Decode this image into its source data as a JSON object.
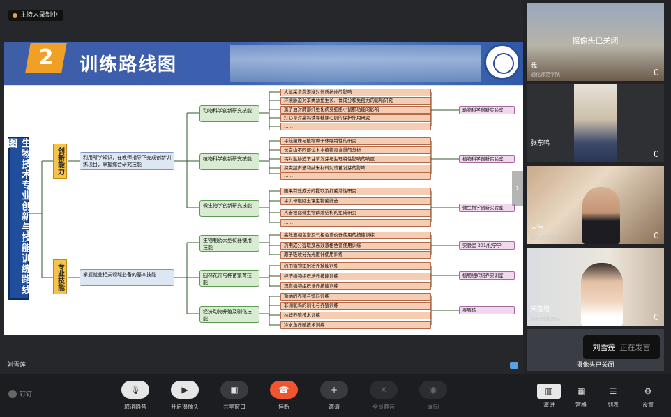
{
  "main": {
    "host_tag": "主持人录制中",
    "speaker_name": "刘雪莲"
  },
  "slide": {
    "number": "2",
    "title": "训练路线图",
    "vertical_title": "生物技术专业创新与技能训练路线图",
    "categories": [
      "创新能力",
      "专业技能"
    ],
    "descriptions": [
      "利用所学知识，在教师指导下完成创新训练项目，掌握综合研究技能",
      "掌握就业相关领域必备的基本技能"
    ],
    "mids": [
      "动物科学创新研究技能",
      "植物科学创新研究技能",
      "微生物学创新研究技能",
      "生物制药大型仪器使用技能",
      "园林花卉与种苗繁育技能",
      "经济动物养殖及驯化技能"
    ],
    "groups": [
      [
        "大鼠采食费游泳对体质抗体的影响",
        "环境胁迫对苯类幼鱼生长、体成分和免疫力的影响研究",
        "藻子油对肺部纤维化病变细胞小鼠肝功能的影响",
        "灯心草对高钙诱导糖尿心肌的保护作用研究",
        "……"
      ],
      [
        "平菇菌株与植物种子休眠特性的研究",
        "长白山不同部位木本植物氮含量的分析",
        "钙对盐胁迫下甘草发芽与生理特性影响的响应",
        "探究超声波和纳米材料对蒜苗发芽的影响",
        "……"
      ],
      [
        "腰果有效成分的提取及抑菌活性研究",
        "平贝母根际土壤生物菌筛选",
        "人参根际微生物群落结构的组成研究",
        "……"
      ],
      [
        "高效液相色谱及气相色谱仪器使用的技能训练",
        "药用成分提取及高效液相色谱使用训练",
        "原子吸收分光光度计使用训练"
      ],
      [
        "药用植物组织培养技能训练",
        "经济植物组织培养技能训练",
        "观赏植物组织培养技能训练"
      ],
      [
        "微纳的养殖与饲料训练",
        "非洲鸵鸟的驯化与养殖训练",
        "林蛙养殖技术训练",
        "冷水鱼养殖技术训练"
      ]
    ],
    "destinations": [
      "动物科学创新实验室",
      "植物科学创新实验室",
      "微生物学创新实验室",
      "实验室 301/化学学",
      "植物组织培养实训室",
      "养殖场"
    ]
  },
  "tiles": [
    {
      "name": "我",
      "sub": "通化师范学院",
      "cam_text": "摄像头已关闭"
    },
    {
      "name": "张东鸣",
      "sub": ""
    },
    {
      "name": "宋伟",
      "sub": "通化师范大学"
    },
    {
      "name": "宋圣增",
      "sub": "通化市教育局"
    },
    {
      "name": "",
      "sub": "",
      "cam_text": "摄像头已关闭"
    }
  ],
  "speaking": {
    "name": "刘雪莲",
    "status": "正在发言"
  },
  "toolbar": {
    "brand": "钉钉",
    "controls": [
      "取消静音",
      "开启摄像头",
      "共享窗口",
      "挂断",
      "邀请",
      "全员静音",
      "录制"
    ],
    "right": [
      "演讲",
      "宫格",
      "列表",
      "设置"
    ]
  },
  "colors": {
    "hangup": "#f0552f",
    "slide_blue": "#1f4e9c",
    "category_yellow": "#f5c24a"
  },
  "icons": [
    "mic-off-icon",
    "camera-off-icon",
    "share-screen-icon",
    "hangup-phone-icon",
    "invite-user-icon",
    "mute-all-icon",
    "record-icon",
    "speaker-view-icon",
    "grid-view-icon",
    "list-view-icon",
    "settings-gear-icon"
  ]
}
